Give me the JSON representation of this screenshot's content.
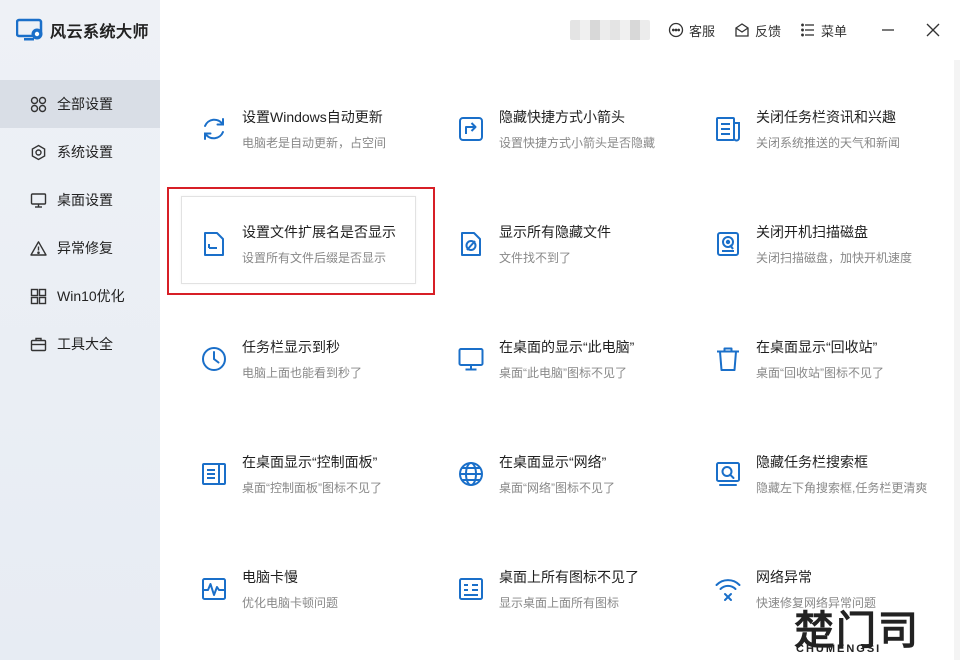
{
  "app": {
    "title": "风云系统大师"
  },
  "sidebar": {
    "items": [
      {
        "label": "全部设置",
        "icon": "grid-icon",
        "active": true
      },
      {
        "label": "系统设置",
        "icon": "gear-icon",
        "active": false
      },
      {
        "label": "桌面设置",
        "icon": "monitor-icon",
        "active": false
      },
      {
        "label": "异常修复",
        "icon": "warning-icon",
        "active": false
      },
      {
        "label": "Win10优化",
        "icon": "windows-icon",
        "active": false
      },
      {
        "label": "工具大全",
        "icon": "toolbox-icon",
        "active": false
      }
    ]
  },
  "topbar": {
    "service_label": "客服",
    "feedback_label": "反馈",
    "menu_label": "菜单"
  },
  "settings": [
    {
      "title": "设置Windows自动更新",
      "desc": "电脑老是自动更新，占空间",
      "icon": "refresh-icon"
    },
    {
      "title": "隐藏快捷方式小箭头",
      "desc": "设置快捷方式小箭头是否隐藏",
      "icon": "shortcut-arrow-icon"
    },
    {
      "title": "关闭任务栏资讯和兴趣",
      "desc": "关闭系统推送的天气和新闻",
      "icon": "news-icon"
    },
    {
      "title": "设置文件扩展名是否显示",
      "desc": "设置所有文件后缀是否显示",
      "icon": "file-icon"
    },
    {
      "title": "显示所有隐藏文件",
      "desc": "文件找不到了",
      "icon": "hidden-file-icon"
    },
    {
      "title": "关闭开机扫描磁盘",
      "desc": "关闭扫描磁盘，加快开机速度",
      "icon": "disk-scan-icon"
    },
    {
      "title": "任务栏显示到秒",
      "desc": "电脑上面也能看到秒了",
      "icon": "clock-icon"
    },
    {
      "title": "在桌面的显示“此电脑”",
      "desc": "桌面“此电脑”图标不见了",
      "icon": "monitor-icon"
    },
    {
      "title": "在桌面显示“回收站”",
      "desc": "桌面“回收站”图标不见了",
      "icon": "trash-icon"
    },
    {
      "title": "在桌面显示“控制面板”",
      "desc": "桌面“控制面板”图标不见了",
      "icon": "control-panel-icon"
    },
    {
      "title": "在桌面显示“网络”",
      "desc": "桌面“网络”图标不见了",
      "icon": "globe-icon"
    },
    {
      "title": "隐藏任务栏搜索框",
      "desc": "隐藏左下角搜索框,任务栏更清爽",
      "icon": "search-box-icon"
    },
    {
      "title": "电脑卡慢",
      "desc": "优化电脑卡顿问题",
      "icon": "pulse-icon"
    },
    {
      "title": "桌面上所有图标不见了",
      "desc": "显示桌面上面所有图标",
      "icon": "desktop-icons-icon"
    },
    {
      "title": "网络异常",
      "desc": "快速修复网络异常问题",
      "icon": "wifi-error-icon"
    }
  ],
  "watermark": {
    "main": "楚门司",
    "sub": "CHUMENGSI"
  },
  "colors": {
    "accent": "#1a6fc9",
    "highlight": "#d71f26",
    "sidebar_bg": "#eef1f6",
    "sidebar_active": "#d9dee6"
  }
}
